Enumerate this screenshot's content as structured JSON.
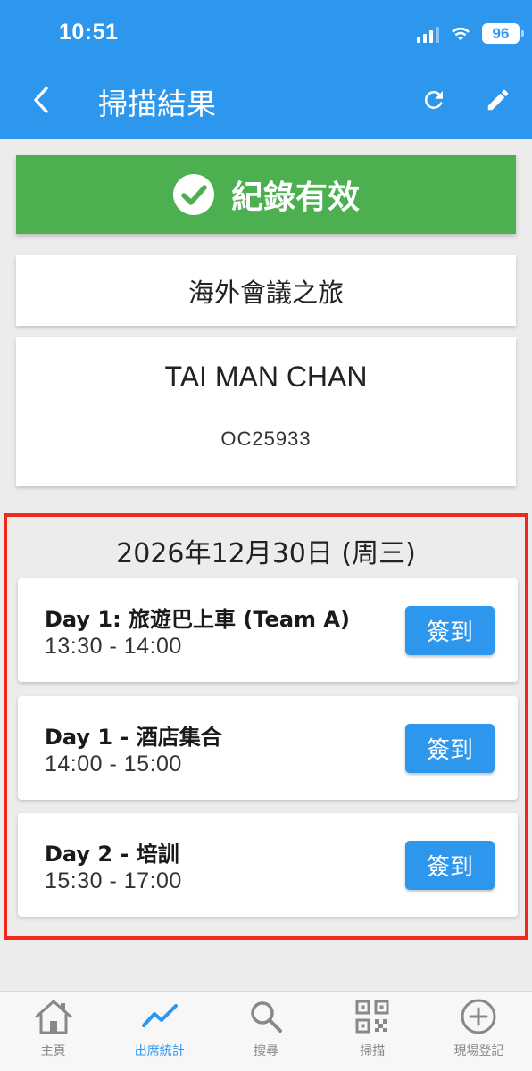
{
  "status_bar": {
    "time": "10:51",
    "battery": "96"
  },
  "header": {
    "title": "掃描結果"
  },
  "result": {
    "label": "紀錄有效"
  },
  "event": {
    "name": "海外會議之旅"
  },
  "person": {
    "name": "TAI MAN CHAN",
    "code": "OC25933"
  },
  "schedule": {
    "date": "2026年12月30日 (周三)",
    "sessions": [
      {
        "title": "Day 1: 旅遊巴上車 (Team A)",
        "time": "13:30 - 14:00",
        "button": "簽到"
      },
      {
        "title": "Day 1 - 酒店集合",
        "time": "14:00 - 15:00",
        "button": "簽到"
      },
      {
        "title": "Day 2 - 培訓",
        "time": "15:30 - 17:00",
        "button": "簽到"
      }
    ]
  },
  "bottom_nav": {
    "items": [
      {
        "label": "主頁",
        "icon": "home-icon"
      },
      {
        "label": "出席統計",
        "icon": "trend-chart-icon",
        "active": true
      },
      {
        "label": "搜尋",
        "icon": "search-icon"
      },
      {
        "label": "掃描",
        "icon": "qr-code-icon"
      },
      {
        "label": "現場登記",
        "icon": "add-circle-icon"
      }
    ]
  },
  "colors": {
    "primary": "#2d96ed",
    "success": "#4caf50",
    "highlight_border": "#ee2a1a"
  }
}
